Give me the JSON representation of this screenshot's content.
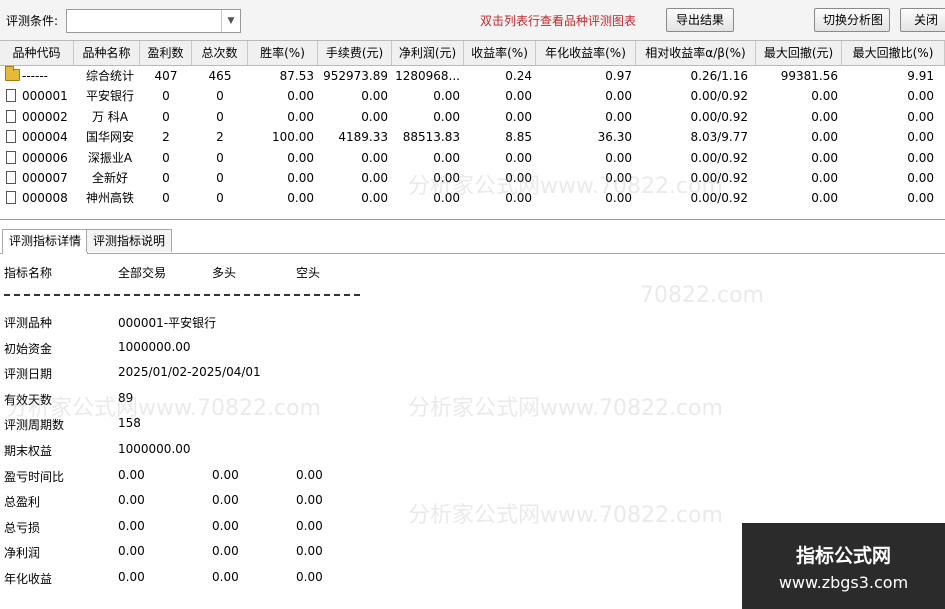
{
  "toolbar": {
    "condition_label": "评测条件:",
    "condition_value": "",
    "hint": "双击列表行查看品种评测图表",
    "export_label": "导出结果",
    "switch_label": "切换分析图",
    "close_label": "关闭"
  },
  "table": {
    "columns": [
      "品种代码",
      "品种名称",
      "盈利数",
      "总次数",
      "胜率(%)",
      "手续费(元)",
      "净利润(元)",
      "收益率(%)",
      "年化收益率(%)",
      "相对收益率α/β(%)",
      "最大回撤(元)",
      "最大回撤比(%)"
    ],
    "rows": [
      {
        "icon": "folder-icon",
        "code": "------",
        "name": "综合统计",
        "win": "407",
        "total": "465",
        "rate": "87.53",
        "fee": "952973.89",
        "profit": "1280968...",
        "ret": "0.24",
        "annual": "0.97",
        "alpha": "0.26/1.16",
        "maxdd": "99381.56",
        "maxddp": "9.91"
      },
      {
        "icon": "document-icon",
        "code": "000001",
        "name": "平安银行",
        "win": "0",
        "total": "0",
        "rate": "0.00",
        "fee": "0.00",
        "profit": "0.00",
        "ret": "0.00",
        "annual": "0.00",
        "alpha": "0.00/0.92",
        "maxdd": "0.00",
        "maxddp": "0.00"
      },
      {
        "icon": "document-icon",
        "code": "000002",
        "name": "万 科A",
        "win": "0",
        "total": "0",
        "rate": "0.00",
        "fee": "0.00",
        "profit": "0.00",
        "ret": "0.00",
        "annual": "0.00",
        "alpha": "0.00/0.92",
        "maxdd": "0.00",
        "maxddp": "0.00"
      },
      {
        "icon": "document-icon",
        "code": "000004",
        "name": "国华网安",
        "win": "2",
        "total": "2",
        "rate": "100.00",
        "fee": "4189.33",
        "profit": "88513.83",
        "ret": "8.85",
        "annual": "36.30",
        "alpha": "8.03/9.77",
        "maxdd": "0.00",
        "maxddp": "0.00"
      },
      {
        "icon": "document-icon",
        "code": "000006",
        "name": "深振业A",
        "win": "0",
        "total": "0",
        "rate": "0.00",
        "fee": "0.00",
        "profit": "0.00",
        "ret": "0.00",
        "annual": "0.00",
        "alpha": "0.00/0.92",
        "maxdd": "0.00",
        "maxddp": "0.00"
      },
      {
        "icon": "document-icon",
        "code": "000007",
        "name": "全新好",
        "win": "0",
        "total": "0",
        "rate": "0.00",
        "fee": "0.00",
        "profit": "0.00",
        "ret": "0.00",
        "annual": "0.00",
        "alpha": "0.00/0.92",
        "maxdd": "0.00",
        "maxddp": "0.00"
      },
      {
        "icon": "document-icon",
        "code": "000008",
        "name": "神州高铁",
        "win": "0",
        "total": "0",
        "rate": "0.00",
        "fee": "0.00",
        "profit": "0.00",
        "ret": "0.00",
        "annual": "0.00",
        "alpha": "0.00/0.92",
        "maxdd": "0.00",
        "maxddp": "0.00"
      }
    ]
  },
  "tabs": [
    {
      "label": "评测指标详情",
      "active": true
    },
    {
      "label": "评测指标说明",
      "active": false
    }
  ],
  "detail": {
    "headers": [
      "指标名称",
      "全部交易",
      "多头",
      "空头"
    ],
    "rows": [
      {
        "label": "评测品种",
        "values": [
          "000001-平安银行"
        ]
      },
      {
        "label": "初始资金",
        "values": [
          "1000000.00"
        ]
      },
      {
        "label": "评测日期",
        "values": [
          "2025/01/02-2025/04/01"
        ]
      },
      {
        "label": "有效天数",
        "values": [
          "89"
        ]
      },
      {
        "label": "评测周期数",
        "values": [
          "158"
        ]
      },
      {
        "label": "期末权益",
        "values": [
          "1000000.00"
        ]
      },
      {
        "label": "盈亏时间比",
        "values": [
          "0.00",
          "0.00",
          "0.00"
        ]
      },
      {
        "label": "总盈利",
        "values": [
          "0.00",
          "0.00",
          "0.00"
        ]
      },
      {
        "label": "总亏损",
        "values": [
          "0.00",
          "0.00",
          "0.00"
        ]
      },
      {
        "label": "净利润",
        "values": [
          "0.00",
          "0.00",
          "0.00"
        ]
      },
      {
        "label": "年化收益",
        "values": [
          "0.00",
          "0.00",
          "0.00"
        ]
      }
    ]
  },
  "watermarks": [
    "分析家公式网www.70822.com",
    "70822.com",
    "分析家公式网www.70822.com",
    "分析家公式网www.70822.com",
    "分析家公式网www.70822.com"
  ],
  "badge": {
    "title": "指标公式网",
    "url": "www.zbgs3.com"
  },
  "colors": {
    "hint": "#c0282d",
    "folder": "#e8b83a",
    "badge_bg": "#2b2b2b"
  }
}
